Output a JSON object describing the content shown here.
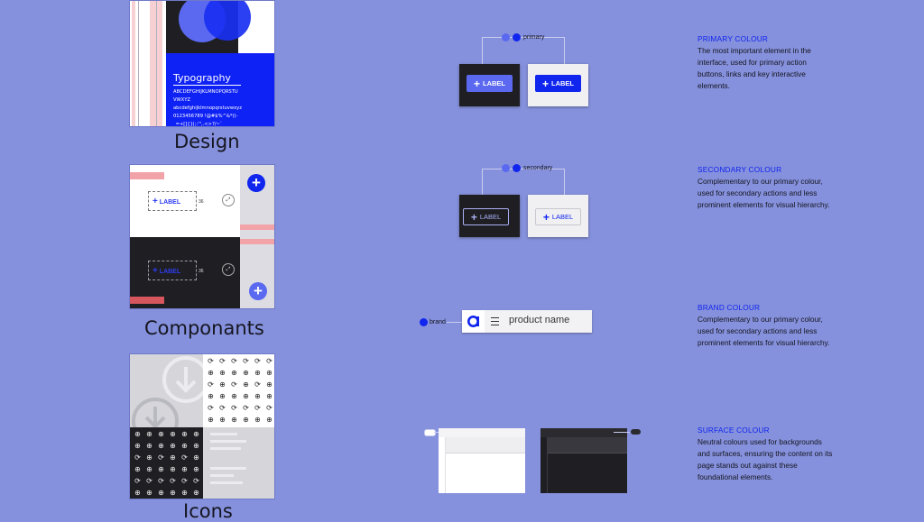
{
  "thumbnails": {
    "design": {
      "caption": "Design",
      "typography_title": "Typography",
      "sample_lines": [
        "ABCDEFGHIJKLMNOPQRSTU",
        "VWXYZ",
        "abcdefghijklmnopqrstuvwxyz",
        "0123456789 !@#$%^&*()-",
        "_=+[]{}|;:'\",.<>?/~`"
      ]
    },
    "components": {
      "caption": "Componants",
      "label": "LABEL",
      "measure": "36"
    },
    "icons": {
      "caption": "Icons"
    }
  },
  "tokens": {
    "primary": {
      "token": "primary",
      "label": "LABEL"
    },
    "secondary": {
      "token": "secondary",
      "label": "LABEL"
    },
    "brand": {
      "token": "brand",
      "product_name": "product name"
    }
  },
  "descriptions": [
    {
      "title": "PRIMARY COLOUR",
      "body": "The most important element in the interface, used for primary action buttons, links and key interactive elements."
    },
    {
      "title": "SECONDARY COLOUR",
      "body": "Complementary to our primary colour, used for secondary actions and less prominent elements for visual hierarchy."
    },
    {
      "title": "BRAND COLOUR",
      "body": "Complementary to our primary colour, used for secondary actions and less prominent elements for visual hierarchy."
    },
    {
      "title": "SURFACE COLOUR",
      "body": "Neutral colours used for backgrounds and surfaces, ensuring the content on its page stands out against these foundational elements."
    }
  ],
  "colors": {
    "background": "#8591dc",
    "primary": "#1025ee",
    "primary_soft": "#6874e8",
    "dark_surface": "#1f1f23",
    "light_surface": "#f0f0f2",
    "brand": "#1025ee"
  }
}
